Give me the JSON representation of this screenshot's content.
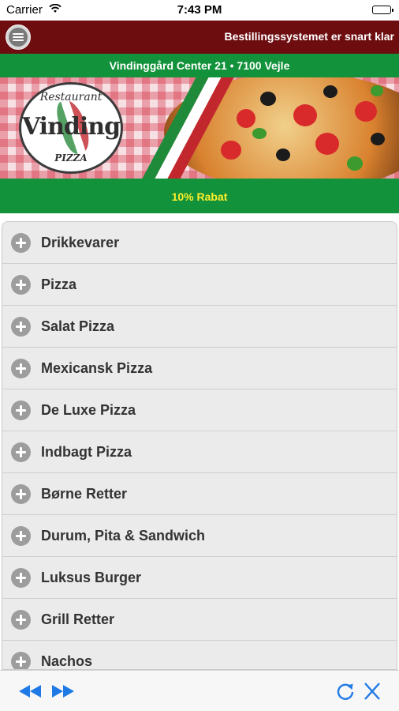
{
  "status_bar": {
    "carrier": "Carrier",
    "time": "7:43 PM"
  },
  "header": {
    "status_text": "Bestillingssystemet er snart klar",
    "menu_icon": "hamburger-menu-icon"
  },
  "address": {
    "text": "Vindinggård Center 21 • 7100 Vejle"
  },
  "banner": {
    "logo_top": "Restaurant",
    "logo_name": "Vinding",
    "logo_bottom": "PIZZA"
  },
  "discount": {
    "text": "10% Rabat"
  },
  "categories": [
    {
      "label": "Drikkevarer"
    },
    {
      "label": "Pizza"
    },
    {
      "label": "Salat Pizza"
    },
    {
      "label": "Mexicansk Pizza"
    },
    {
      "label": "De Luxe Pizza"
    },
    {
      "label": "Indbagt Pizza"
    },
    {
      "label": "Børne Retter"
    },
    {
      "label": "Durum, Pita & Sandwich"
    },
    {
      "label": "Luksus Burger"
    },
    {
      "label": "Grill Retter"
    },
    {
      "label": "Nachos"
    }
  ],
  "toolbar": {
    "back_icon": "rewind-icon",
    "forward_icon": "fast-forward-icon",
    "reload_icon": "reload-icon",
    "close_icon": "close-icon"
  },
  "colors": {
    "header_red": "#6e0d10",
    "bar_green": "#12923a",
    "discount_text": "#ffef2b",
    "toolbar_blue": "#1f7ae6"
  }
}
